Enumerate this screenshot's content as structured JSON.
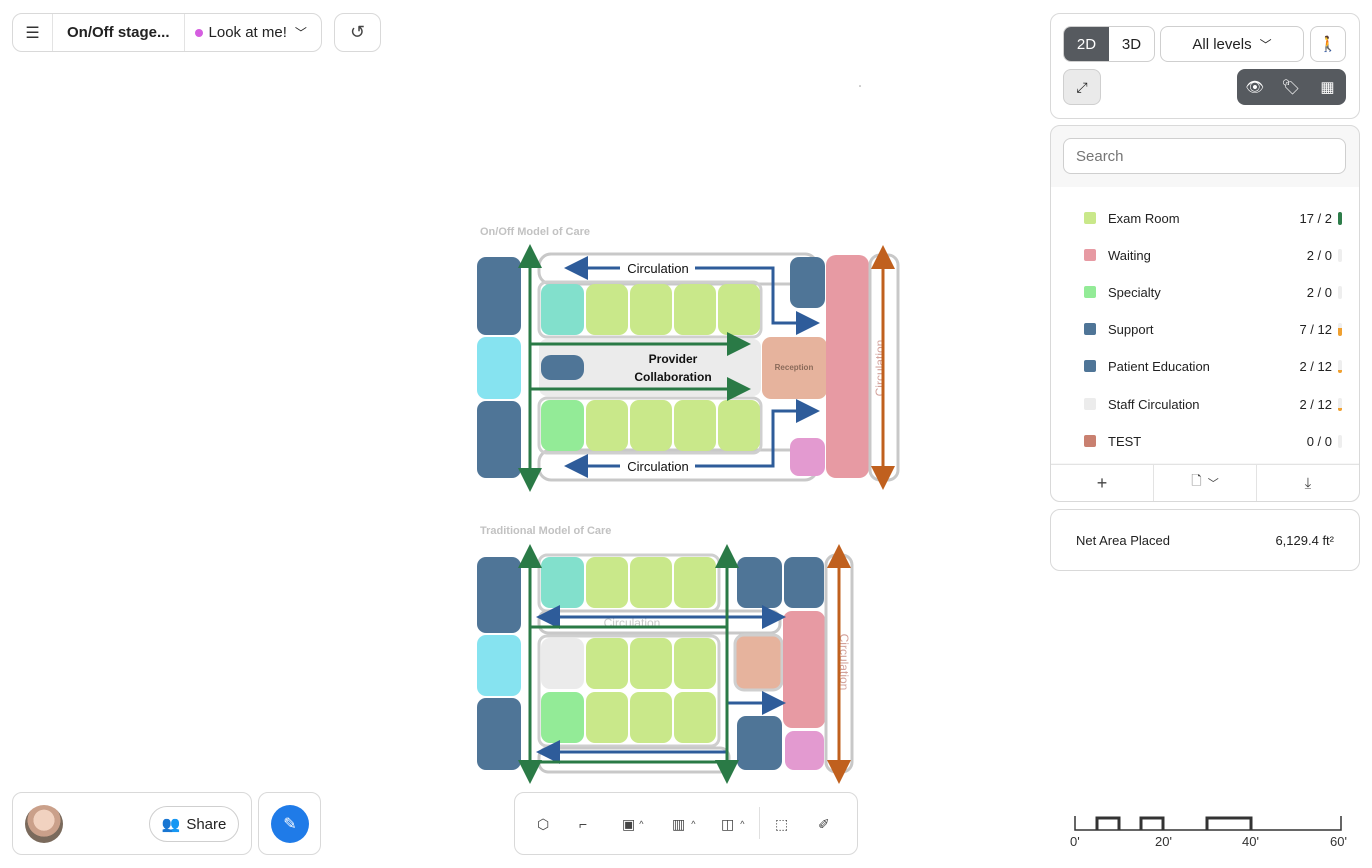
{
  "topbar": {
    "menu_icon": "hamburger-menu-icon",
    "project_title": "On/Off stage...",
    "stage_label": "Look at me!",
    "stage_dot_color": "#d55ee0"
  },
  "view": {
    "mode_2d": "2D",
    "mode_3d": "3D",
    "active_mode": "2D",
    "levels": "All levels"
  },
  "search": {
    "placeholder": "Search"
  },
  "legend": [
    {
      "name": "Exam Room",
      "count": "17 / 2",
      "color": "#c9e88a",
      "fill": 1.0,
      "bar_color": "#2e7d4a"
    },
    {
      "name": "Waiting",
      "count": "2 / 0",
      "color": "#e79aa3",
      "fill": 0.0,
      "bar_color": "#e5e5e5"
    },
    {
      "name": "Specialty",
      "count": "2 / 0",
      "color": "#93eb97",
      "fill": 0.0,
      "bar_color": "#e5e5e5"
    },
    {
      "name": "Support",
      "count": "7 / 12",
      "color": "#4f7597",
      "fill": 0.58,
      "bar_color": "#f0a030"
    },
    {
      "name": "Patient Education",
      "count": "2 / 12",
      "color": "#4f7597",
      "fill": 0.17,
      "bar_color": "#f0a030"
    },
    {
      "name": "Staff Circulation",
      "count": "2 / 12",
      "color": "#ececec",
      "fill": 0.17,
      "bar_color": "#f0a030"
    },
    {
      "name": "TEST",
      "count": "0 / 0",
      "color": "#c98070",
      "fill": 0.0,
      "bar_color": "#e5e5e5"
    }
  ],
  "net_area": {
    "label": "Net Area Placed",
    "value": "6,129.4 ft²"
  },
  "share": {
    "label": "Share"
  },
  "scale_ticks": [
    "0'",
    "20'",
    "40'",
    "60'"
  ],
  "plans": {
    "onoff": {
      "title": "On/Off Model of Care",
      "circulation_top": "Circulation",
      "circulation_bottom": "Circulation",
      "collab": "Provider Collaboration",
      "reception": "Reception",
      "vertical_circ": "Circulation"
    },
    "traditional": {
      "title": "Traditional Model of Care",
      "circulation": "Circulation",
      "vertical_circ": "Circulation"
    }
  }
}
